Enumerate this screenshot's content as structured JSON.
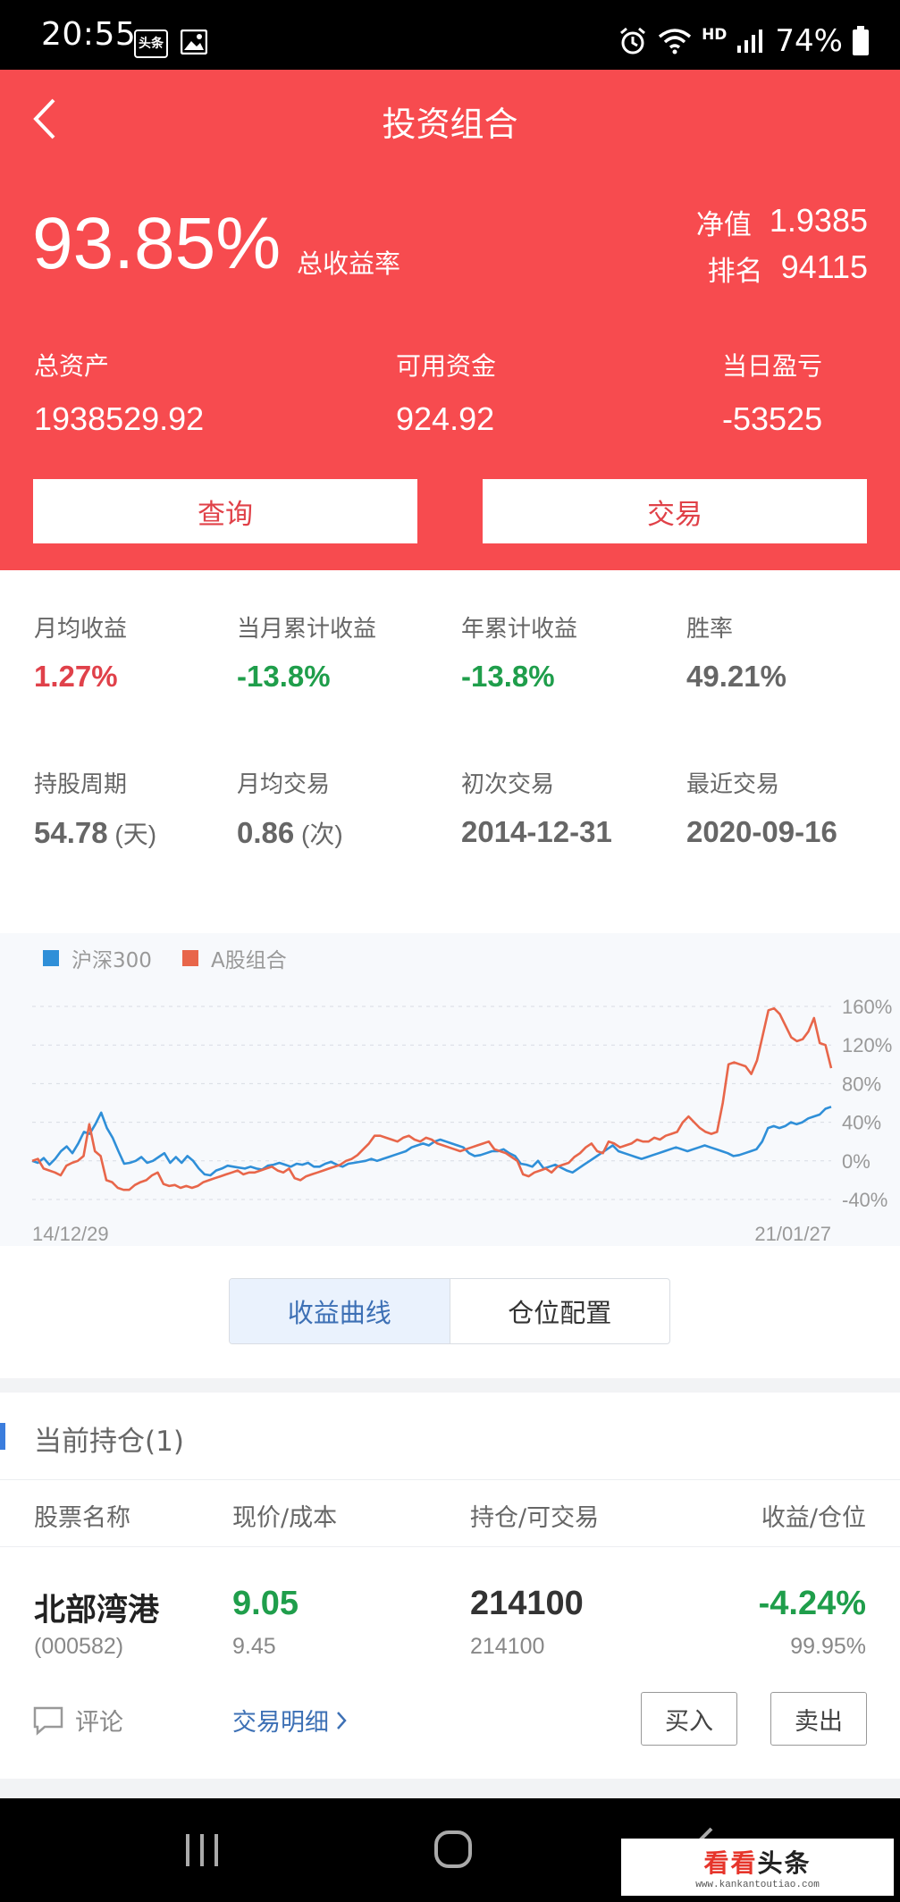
{
  "status_bar": {
    "time": "20:55",
    "badge": "头条",
    "hd": "HD",
    "battery": "74%"
  },
  "header": {
    "title": "投资组合",
    "total_return": "93.85%",
    "total_return_label": "总收益率",
    "nav_label": "净值",
    "nav_value": "1.9385",
    "rank_label": "排名",
    "rank_value": "94115",
    "stats": [
      {
        "label": "总资产",
        "value": "1938529.92"
      },
      {
        "label": "可用资金",
        "value": "924.92"
      },
      {
        "label": "当日盈亏",
        "value": "-53525"
      }
    ],
    "query_button": "查询",
    "trade_button": "交易"
  },
  "metrics": {
    "row1": [
      {
        "label": "月均收益",
        "value": "1.27%"
      },
      {
        "label": "当月累计收益",
        "value": "-13.8%"
      },
      {
        "label": "年累计收益",
        "value": "-13.8%"
      },
      {
        "label": "胜率",
        "value": "49.21%"
      }
    ],
    "row2": [
      {
        "label": "持股周期",
        "value": "54.78",
        "unit": " (天)"
      },
      {
        "label": "月均交易",
        "value": "0.86",
        "unit": " (次)"
      },
      {
        "label": "初次交易",
        "value": "2014-12-31"
      },
      {
        "label": "最近交易",
        "value": "2020-09-16"
      }
    ]
  },
  "chart_data": {
    "type": "line",
    "x_start_label": "14/12/29",
    "x_end_label": "21/01/27",
    "y_ticks": [
      "160%",
      "120%",
      "80%",
      "40%",
      "0%",
      "-40%"
    ],
    "ylim": [
      -40,
      160
    ],
    "grid": true,
    "legend_position": "top-left",
    "series": [
      {
        "name": "沪深300",
        "color": "#2f8fd8",
        "values": [
          0,
          -2,
          3,
          -4,
          2,
          10,
          15,
          8,
          18,
          30,
          28,
          38,
          50,
          34,
          24,
          10,
          -3,
          -2,
          0,
          4,
          -2,
          0,
          4,
          8,
          -2,
          4,
          -2,
          5,
          0,
          -8,
          -14,
          -15,
          -10,
          -8,
          -5,
          -6,
          -7,
          -8,
          -6,
          -8,
          -9,
          -5,
          -4,
          -2,
          -4,
          -6,
          -3,
          -4,
          -2,
          -6,
          -6,
          -3,
          -1,
          -4,
          -6,
          -3,
          -2,
          -1,
          0,
          2,
          0,
          2,
          4,
          6,
          8,
          10,
          14,
          16,
          18,
          16,
          20,
          22,
          20,
          18,
          16,
          14,
          8,
          5,
          6,
          8,
          10,
          10,
          12,
          8,
          5,
          -3,
          -4,
          -6,
          0,
          -8,
          -6,
          -4,
          -7,
          -10,
          -12,
          -8,
          -4,
          0,
          4,
          8,
          12,
          16,
          10,
          8,
          6,
          4,
          2,
          4,
          6,
          8,
          10,
          12,
          14,
          12,
          10,
          12,
          14,
          16,
          14,
          12,
          10,
          8,
          5,
          6,
          8,
          10,
          12,
          20,
          34,
          36,
          34,
          36,
          40,
          38,
          40,
          44,
          46,
          48,
          54,
          56
        ]
      },
      {
        "name": "A股组合",
        "color": "#e8664a",
        "values": [
          0,
          2,
          -8,
          -10,
          -12,
          -15,
          -5,
          -2,
          0,
          5,
          38,
          10,
          5,
          -20,
          -22,
          -28,
          -30,
          -30,
          -25,
          -22,
          -20,
          -15,
          -12,
          -24,
          -26,
          -25,
          -28,
          -26,
          -28,
          -26,
          -22,
          -20,
          -18,
          -16,
          -14,
          -12,
          -10,
          -14,
          -12,
          -12,
          -10,
          -8,
          -6,
          -10,
          -12,
          -8,
          -18,
          -20,
          -16,
          -14,
          -12,
          -10,
          -8,
          -6,
          -4,
          0,
          2,
          6,
          12,
          18,
          26,
          26,
          24,
          22,
          20,
          24,
          26,
          22,
          20,
          24,
          22,
          18,
          16,
          14,
          12,
          10,
          12,
          14,
          16,
          18,
          20,
          12,
          10,
          8,
          4,
          0,
          -14,
          -16,
          -12,
          -10,
          -8,
          -12,
          -6,
          -4,
          -2,
          4,
          8,
          14,
          18,
          10,
          8,
          20,
          18,
          14,
          16,
          18,
          22,
          20,
          20,
          24,
          22,
          26,
          28,
          30,
          40,
          46,
          40,
          34,
          30,
          28,
          30,
          60,
          100,
          102,
          100,
          98,
          90,
          104,
          130,
          156,
          158,
          152,
          140,
          128,
          124,
          126,
          134,
          148,
          122,
          120,
          96
        ]
      }
    ]
  },
  "chart_tabs": [
    "收益曲线",
    "仓位配置"
  ],
  "holdings": {
    "title": "当前持仓(1)",
    "columns": [
      "股票名称",
      "现价/成本",
      "持仓/可交易",
      "收益/仓位"
    ],
    "rows": [
      {
        "name": "北部湾港",
        "code": "(000582)",
        "price": "9.05",
        "cost": "9.45",
        "position": "214100",
        "available": "214100",
        "return": "-4.24%",
        "weight": "99.95%"
      }
    ],
    "comment_label": "评论",
    "detail_link": "交易明细",
    "buy_button": "买入",
    "sell_button": "卖出"
  },
  "watermark": {
    "brand_red": "看看",
    "brand_dark": "头条",
    "url": "www.kankantoutiao.com"
  },
  "colors": {
    "header_red": "#f74b4f",
    "up_red": "#e0414a",
    "down_green": "#1f9e4b",
    "link_blue": "#3d70b5"
  }
}
